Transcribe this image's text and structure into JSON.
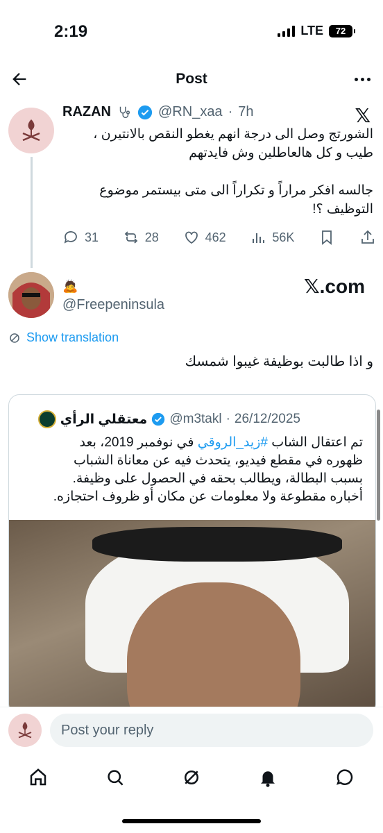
{
  "status_bar": {
    "time": "2:19",
    "network": "LTE",
    "battery": "72"
  },
  "header": {
    "title": "Post"
  },
  "main_tweet": {
    "name": "RAZAN",
    "handle": "@RN_xaa",
    "dot": "·",
    "time": "7h",
    "lines": [
      "الشورتج وصل الى درجة انهم يغطو النقص بالانتيرن ،",
      "طيب و كل هالعاطلين وش فايدتهم",
      "",
      "جالسه افكر مراراً و تكراراً الى متى بيستمر موضوع",
      "التوظيف ؟!"
    ],
    "replies": "31",
    "reposts": "28",
    "likes": "462",
    "views": "56K"
  },
  "embedded": {
    "name": "🙇",
    "handle": "@Freepeninsula",
    "site": "𝕏.com",
    "translate_label": "Show translation",
    "text": "و اذا طالبت بوظيفة غيبوا شمسك"
  },
  "quote": {
    "name": "معتقلي الرأي",
    "handle": "@m3takl",
    "date": "26/12/2025",
    "dot": "·",
    "line1_prefix": "تم اعتقال الشاب ",
    "hashtag": "#زيد_الروقي",
    "line1_suffix": " في نوفمبر 2019، بعد",
    "lines": [
      "ظهوره في مقطع فيديو، يتحدث فيه عن معاناة الشباب",
      "بسبب البطالة، ويطالب بحقه في الحصول على وظيفة.",
      "أخباره مقطوعة ولا معلومات عن مكان أو ظروف احتجازه."
    ]
  },
  "reply": {
    "placeholder": "Post your reply"
  },
  "colors": {
    "accent": "#1d9bf0",
    "muted": "#536471"
  }
}
